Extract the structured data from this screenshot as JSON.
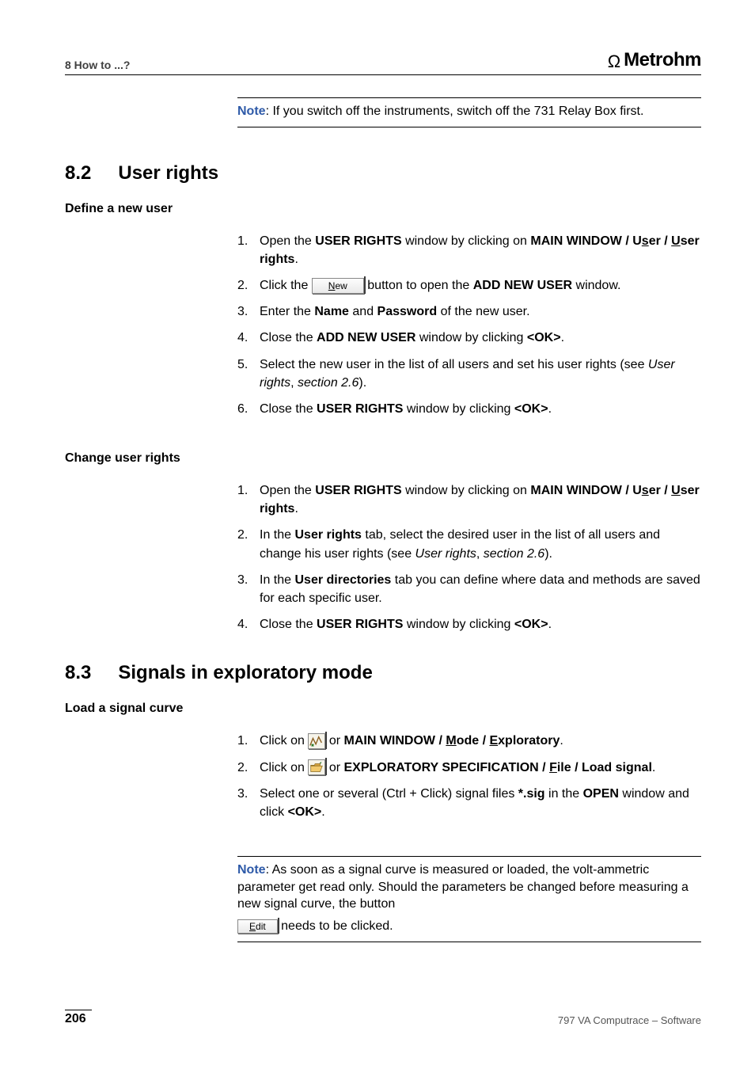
{
  "header": {
    "running_title": "8  How to ...?",
    "brand": "Metrohm"
  },
  "note1": {
    "label": "Note",
    "text": ":  If you switch off the instruments, switch off the 731 Relay Box first."
  },
  "sections": {
    "s82": {
      "num": "8.2",
      "title": "User rights"
    },
    "define_user": {
      "title": "Define a new user",
      "i1a": "Open the ",
      "i1b": "USER RIGHTS",
      "i1c": " window by clicking on ",
      "i1d": "MAIN WINDOW / U",
      "i1e": "s",
      "i1f": "er / ",
      "i1g": "U",
      "i1h": "ser rights",
      "i1i": ".",
      "i2a": "Click the ",
      "btn_new": "ew",
      "btn_new_prefix": "N",
      "i2b": " button to open the ",
      "i2c": "ADD NEW USER",
      "i2d": " window.",
      "i3a": "Enter the ",
      "i3b": "Name",
      "i3c": " and ",
      "i3d": "Password",
      "i3e": " of the new user.",
      "i4a": "Close the ",
      "i4b": "ADD NEW USER",
      "i4c": " window by clicking ",
      "i4d": "<OK>",
      "i4e": ".",
      "i5a": "Select the new user in the list of all users and set his user rights (see ",
      "i5b": "User rights",
      "i5c": ", ",
      "i5d": "section 2.6",
      "i5e": ").",
      "i6a": "Close the ",
      "i6b": "USER RIGHTS",
      "i6c": " window by clicking ",
      "i6d": "<OK>",
      "i6e": "."
    },
    "change_rights": {
      "title": "Change user rights",
      "i1a": "Open the ",
      "i1b": "USER RIGHTS",
      "i1c": " window by clicking on ",
      "i1d": "MAIN WINDOW / U",
      "i1e": "s",
      "i1f": "er / ",
      "i1g": "U",
      "i1h": "ser rights",
      "i1i": ".",
      "i2a": "In the ",
      "i2b": "User rights",
      "i2c": " tab, select the desired user in the list of all users and change his user rights (see ",
      "i2d": "User rights",
      "i2e": ", ",
      "i2f": "section 2.6",
      "i2g": ").",
      "i3a": "In the ",
      "i3b": "User directories",
      "i3c": " tab you can define where data and methods are saved for each specific user.",
      "i4a": "Close the ",
      "i4b": "USER RIGHTS",
      "i4c": " window by clicking ",
      "i4d": "<OK>",
      "i4e": "."
    },
    "s83": {
      "num": "8.3",
      "title": "Signals in exploratory mode"
    },
    "load_signal": {
      "title": "Load a signal curve",
      "i1a": "Click on ",
      "i1b": " or ",
      "i1c": "MAIN WINDOW / ",
      "i1d": "M",
      "i1e": "ode / ",
      "i1f": "E",
      "i1g": "xploratory",
      "i1h": ".",
      "i2a": "Click on ",
      "i2b": " or ",
      "i2c": "EXPLORATORY SPECIFICATION / ",
      "i2d": "F",
      "i2e": "ile / Load signal",
      "i2f": ".",
      "i3a": "Select one or several (Ctrl + Click) signal files ",
      "i3b": "*.sig",
      "i3c": " in the ",
      "i3d": "OPEN",
      "i3e": " window and click ",
      "i3f": "<OK>",
      "i3g": "."
    }
  },
  "note2": {
    "label": "Note",
    "text1": ":  As soon as a signal curve is measured or loaded, the volt-ammetric parameter get read only. Should the parameters be changed before measuring a new signal curve, the button",
    "btn_edit": "dit",
    "btn_edit_prefix": "E",
    "text2": " needs to be clicked."
  },
  "footer": {
    "page": "206",
    "title": "797 VA Computrace – Software"
  }
}
